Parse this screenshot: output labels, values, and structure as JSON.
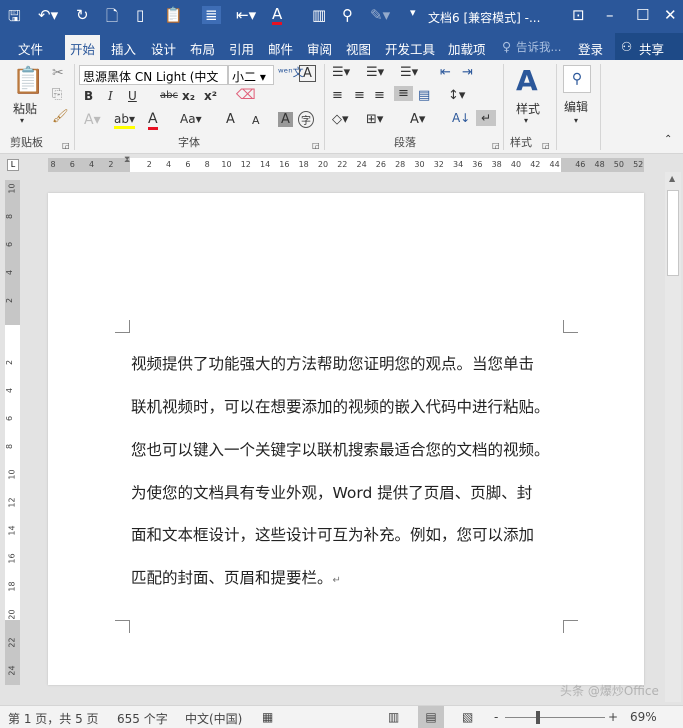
{
  "window": {
    "title": "文档6 [兼容模式] -..."
  },
  "tabs": [
    "文件",
    "开始",
    "插入",
    "设计",
    "布局",
    "引用",
    "邮件",
    "审阅",
    "视图",
    "开发工具",
    "加载项"
  ],
  "tell_me": "告诉我...",
  "signin": "登录",
  "share": "共享",
  "ribbon": {
    "clipboard": {
      "label": "剪贴板",
      "paste": "粘贴"
    },
    "font": {
      "label": "字体",
      "font_name": "思源黑体 CN Light (中文",
      "font_size": "小二",
      "bold": "B",
      "italic": "I",
      "underline": "U",
      "strike": "abc",
      "sub": "x₂",
      "sup": "x²",
      "change_case": "Aa",
      "grow": "A",
      "shrink": "A",
      "shade": "A",
      "enclose": "字"
    },
    "paragraph": {
      "label": "段落"
    },
    "styles": {
      "label": "样式",
      "button": "样式"
    },
    "editing": {
      "button": "编辑"
    }
  },
  "ruler": {
    "h_left": [
      "8",
      "6",
      "4",
      "2"
    ],
    "h_main": [
      "2",
      "4",
      "6",
      "8",
      "10",
      "12",
      "14",
      "16",
      "18",
      "20",
      "22",
      "24",
      "26",
      "28",
      "30",
      "32",
      "34",
      "36",
      "38",
      "40",
      "42",
      "44"
    ],
    "h_right": [
      "46",
      "48",
      "50",
      "52"
    ],
    "v_top": [
      "10",
      "8",
      "6",
      "4",
      "2"
    ],
    "v_main": [
      "2",
      "4",
      "6",
      "8",
      "10",
      "12",
      "14",
      "16",
      "18",
      "20",
      "22",
      "24"
    ]
  },
  "document": {
    "lines": [
      "视频提供了功能强大的方法帮助您证明您的观点。当您单击",
      "联机视频时，可以在想要添加的视频的嵌入代码中进行粘贴。",
      "您也可以键入一个关键字以联机搜索最适合您的文档的视频。",
      "为使您的文档具有专业外观，Word 提供了页眉、页脚、封",
      "面和文本框设计，这些设计可互为补充。例如，您可以添加",
      "匹配的封面、页眉和提要栏。"
    ]
  },
  "status": {
    "page": "第 1 页，共 5 页",
    "words": "655 个字",
    "lang": "中文(中国)",
    "zoom": "69%"
  },
  "watermark": "头条 @爆炒Office",
  "colors": {
    "brand": "#2b579a"
  }
}
